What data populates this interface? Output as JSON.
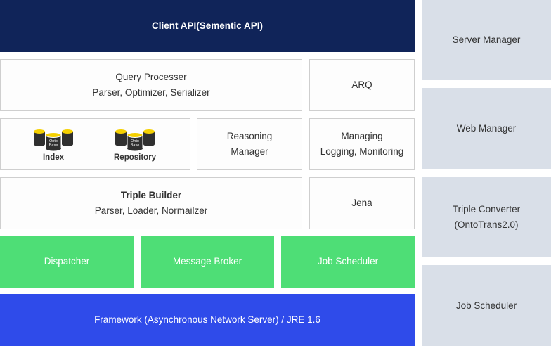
{
  "client_api": "Client API(Sementic API)",
  "query_processer": {
    "title": "Query Processer",
    "sub": "Parser, Optimizer, Serializer"
  },
  "arq": "ARQ",
  "index": {
    "label": "Index",
    "db_text_1": "Onto",
    "db_text_2": "Base"
  },
  "repository": {
    "label": "Repository",
    "db_text_1": "Onto",
    "db_text_2": "Base"
  },
  "reasoning": {
    "line1": "Reasoning",
    "line2": "Manager"
  },
  "managing": {
    "line1": "Managing",
    "line2": "Logging, Monitoring"
  },
  "triple_builder": {
    "title": "Triple Builder",
    "sub": "Parser, Loader, Normailzer"
  },
  "jena": "Jena",
  "dispatcher": "Dispatcher",
  "message_broker": "Message Broker",
  "job_scheduler_main": "Job Scheduler",
  "framework": "Framework (Asynchronous Network Server) / JRE 1.6",
  "side": {
    "server_manager": "Server Manager",
    "web_manager": "Web Manager",
    "triple_converter": {
      "line1": "Triple Converter",
      "line2": "(OntoTrans2.0)"
    },
    "job_scheduler": "Job Scheduler"
  },
  "colors": {
    "navy": "#102459",
    "green": "#4ede76",
    "blue": "#2f4bea",
    "side_panel": "#d9dfe8",
    "db_yellow": "#f5d000",
    "db_dark": "#2f2f2f"
  }
}
